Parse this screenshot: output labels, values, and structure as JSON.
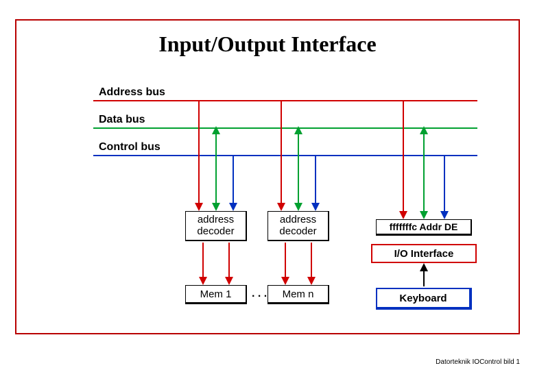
{
  "title": "Input/Output Interface",
  "buses": {
    "address": {
      "label": "Address bus",
      "color": "#d00000"
    },
    "data": {
      "label": "Data bus",
      "color": "#00a030"
    },
    "control": {
      "label": "Control bus",
      "color": "#0030c0"
    }
  },
  "blocks": {
    "decoder1": "address\ndecoder",
    "decoder2": "address\ndecoder",
    "mem1": "Mem 1",
    "memn": "Mem n",
    "register": "fffffffc Addr DE",
    "io_interface": "I/O Interface",
    "keyboard": "Keyboard",
    "ellipsis": ". . ."
  },
  "footer": "Datorteknik IOControl bild 1"
}
